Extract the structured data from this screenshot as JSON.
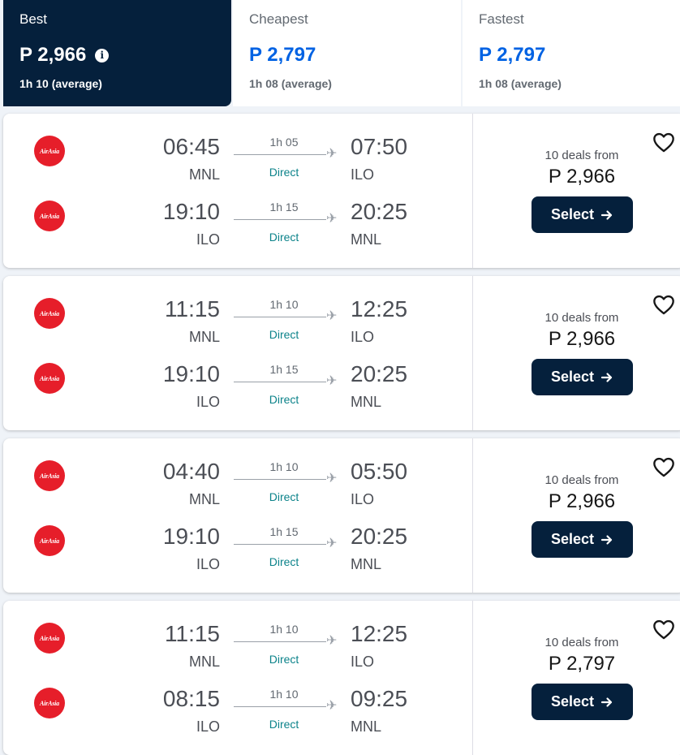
{
  "tabs": [
    {
      "title": "Best",
      "price": "P 2,966",
      "duration": "1h 10 (average)",
      "active": true
    },
    {
      "title": "Cheapest",
      "price": "P 2,797",
      "duration": "1h 08 (average)",
      "active": false
    },
    {
      "title": "Fastest",
      "price": "P 2,797",
      "duration": "1h 08 (average)",
      "active": false
    }
  ],
  "info_icon_glyph": "i",
  "airline_logo_text": "AirAsia",
  "cards": [
    {
      "legs": [
        {
          "dep_time": "06:45",
          "dep_code": "MNL",
          "duration": "1h 05",
          "stops": "Direct",
          "arr_time": "07:50",
          "arr_code": "ILO"
        },
        {
          "dep_time": "19:10",
          "dep_code": "ILO",
          "duration": "1h 15",
          "stops": "Direct",
          "arr_time": "20:25",
          "arr_code": "MNL"
        }
      ],
      "deals": "10 deals from",
      "price": "P 2,966",
      "select_label": "Select"
    },
    {
      "legs": [
        {
          "dep_time": "11:15",
          "dep_code": "MNL",
          "duration": "1h 10",
          "stops": "Direct",
          "arr_time": "12:25",
          "arr_code": "ILO"
        },
        {
          "dep_time": "19:10",
          "dep_code": "ILO",
          "duration": "1h 15",
          "stops": "Direct",
          "arr_time": "20:25",
          "arr_code": "MNL"
        }
      ],
      "deals": "10 deals from",
      "price": "P 2,966",
      "select_label": "Select"
    },
    {
      "legs": [
        {
          "dep_time": "04:40",
          "dep_code": "MNL",
          "duration": "1h 10",
          "stops": "Direct",
          "arr_time": "05:50",
          "arr_code": "ILO"
        },
        {
          "dep_time": "19:10",
          "dep_code": "ILO",
          "duration": "1h 15",
          "stops": "Direct",
          "arr_time": "20:25",
          "arr_code": "MNL"
        }
      ],
      "deals": "10 deals from",
      "price": "P 2,966",
      "select_label": "Select"
    },
    {
      "legs": [
        {
          "dep_time": "11:15",
          "dep_code": "MNL",
          "duration": "1h 10",
          "stops": "Direct",
          "arr_time": "12:25",
          "arr_code": "ILO"
        },
        {
          "dep_time": "08:15",
          "dep_code": "ILO",
          "duration": "1h 10",
          "stops": "Direct",
          "arr_time": "09:25",
          "arr_code": "MNL"
        }
      ],
      "deals": "10 deals from",
      "price": "P 2,797",
      "select_label": "Select"
    }
  ],
  "colors": {
    "brand_navy": "#05203c",
    "price_blue": "#0062e3",
    "direct_teal": "#0c838a",
    "airline_red": "#e61e2a"
  },
  "icons": {
    "favorite": "heart-icon",
    "select_arrow": "arrow-right-icon",
    "plane": "plane-icon",
    "info": "info-icon"
  }
}
